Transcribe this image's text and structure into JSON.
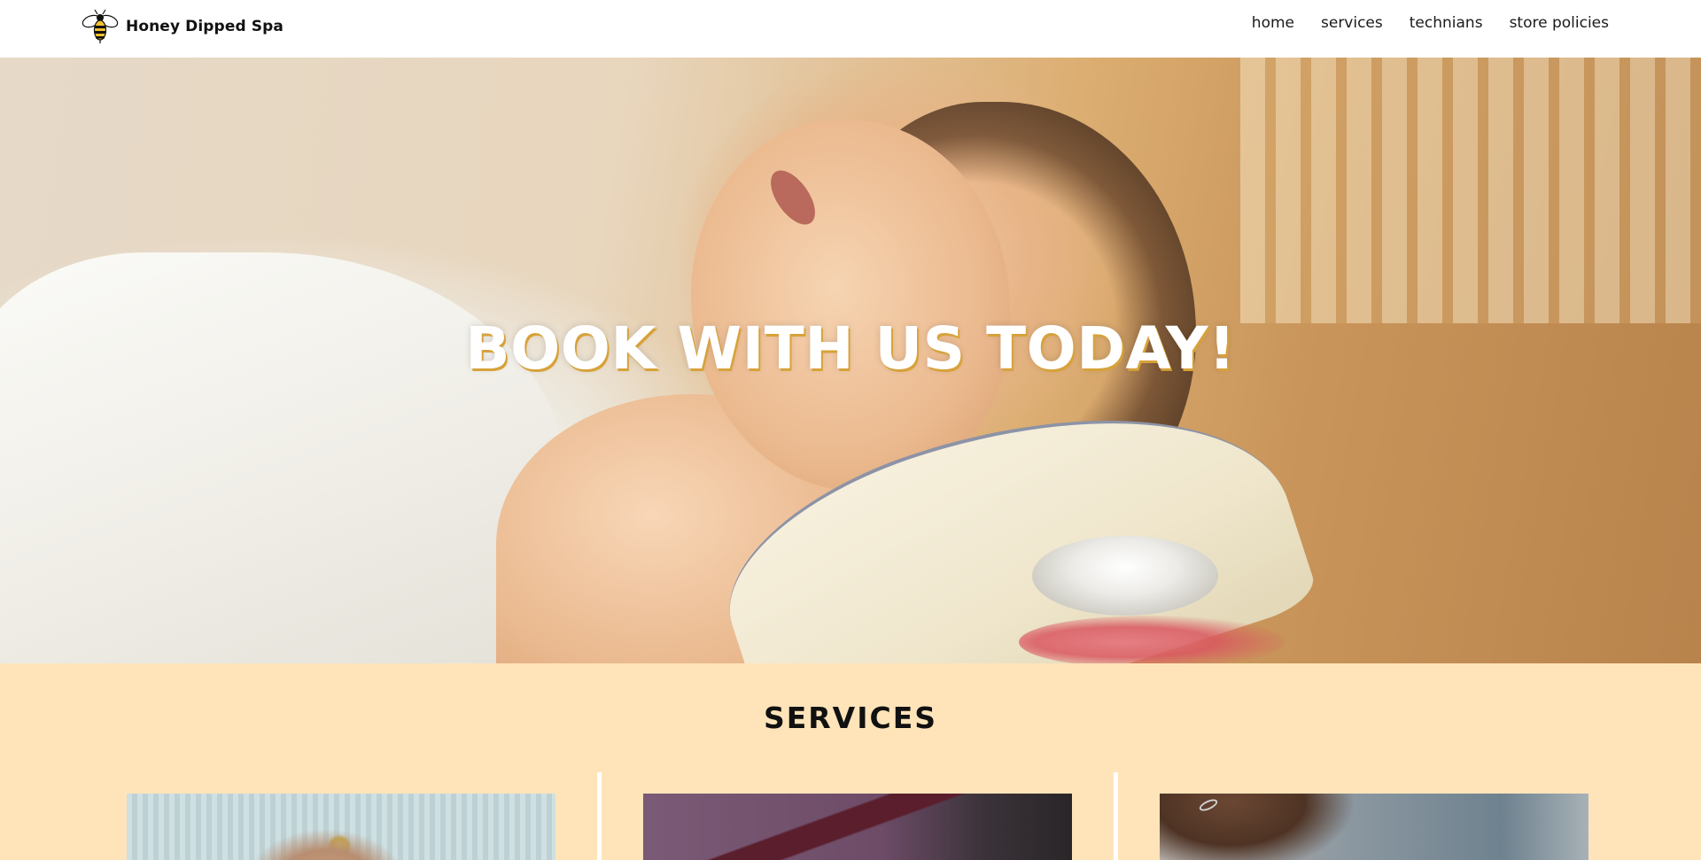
{
  "header": {
    "brand_name": "Honey Dipped Spa",
    "logo_icon": "bee-icon",
    "nav": [
      {
        "label": "home"
      },
      {
        "label": "services"
      },
      {
        "label": "technians"
      },
      {
        "label": "store policies"
      }
    ]
  },
  "hero": {
    "title": "BOOK WITH US TODAY!",
    "image": "woman-relaxing-spa-photo"
  },
  "services": {
    "title": "SERVICES",
    "background_color": "#ffe4ba",
    "cards": [
      {
        "image": "spa-treatment-photo"
      },
      {
        "image": "spa-room-photo"
      },
      {
        "image": "hand-care-photo"
      }
    ]
  },
  "colors": {
    "accent_gold": "#d7a23a",
    "header_bg": "#ffffff",
    "text": "#111111"
  }
}
